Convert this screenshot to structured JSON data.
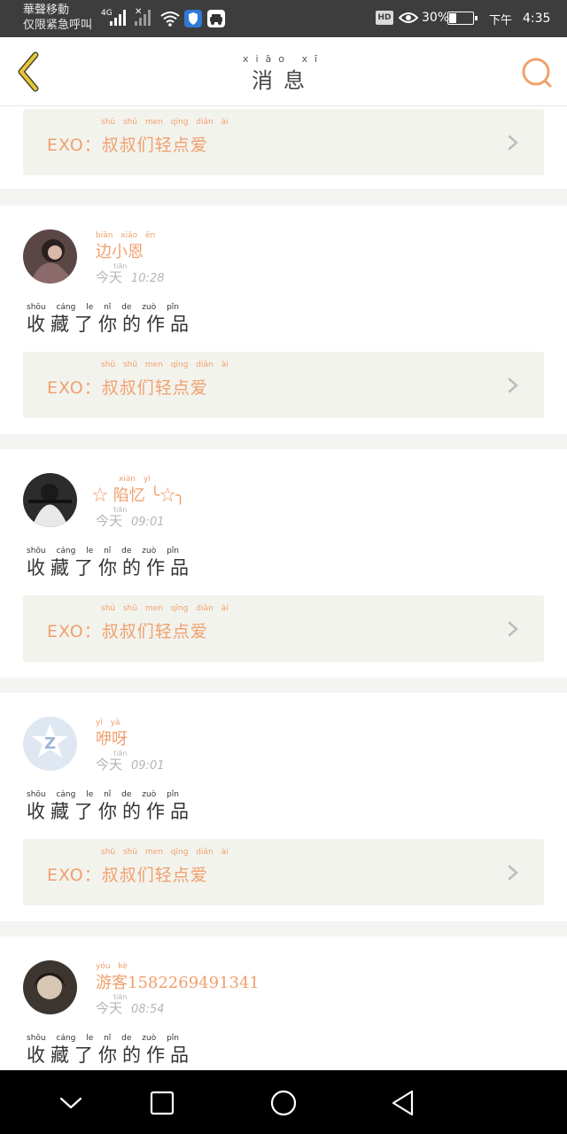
{
  "status_bar": {
    "carrier_line1": "華聲移動",
    "carrier_line2": "仅限紧急呼叫",
    "network": "4G",
    "battery_percent": "30%",
    "ampm": "下午",
    "time": "4:35",
    "hd_label": "HD"
  },
  "header": {
    "title_pinyin": "xiāo xī",
    "title": "消息"
  },
  "card_label": "EXO：叔叔们轻点爱",
  "card_pinyin": "shū shū men qīng diǎn ài",
  "messages": [
    {
      "name": "边小恩",
      "name_pinyin": "biān xiǎo ēn",
      "meta_prefix": "今天",
      "meta_pinyin": "tiān",
      "time": "10:28",
      "action": "收藏了你的作品",
      "action_pinyin": "shōu cáng le nǐ de zuò pǐn",
      "avatar_color": "#4a3a3a"
    },
    {
      "name": "☆ 陷忆 ╰☆╮",
      "name_pinyin": "xiàn yì",
      "meta_prefix": "今天",
      "meta_pinyin": "tiān",
      "time": "09:01",
      "action": "收藏了你的作品",
      "action_pinyin": "shōu cáng le nǐ de zuò pǐn",
      "avatar_color": "#2a2a2a"
    },
    {
      "name": "咿呀",
      "name_pinyin": "yī yā",
      "meta_prefix": "今天",
      "meta_pinyin": "tiān",
      "time": "09:01",
      "action": "收藏了你的作品",
      "action_pinyin": "shōu cáng le nǐ de zuò pǐn",
      "avatar_color": "#dde6f0"
    },
    {
      "name": "游客15822694913​41",
      "name_pinyin": "yóu kè",
      "meta_prefix": "今天",
      "meta_pinyin": "tiān",
      "time": "08:54",
      "action": "收藏了你的作品",
      "action_pinyin": "shōu cáng le nǐ de zuò pǐn",
      "avatar_color": "#3a3430"
    }
  ],
  "colors": {
    "accent": "#f0a06e",
    "back_arrow": "#e8c63a",
    "card_bg": "#f3f3ed"
  }
}
